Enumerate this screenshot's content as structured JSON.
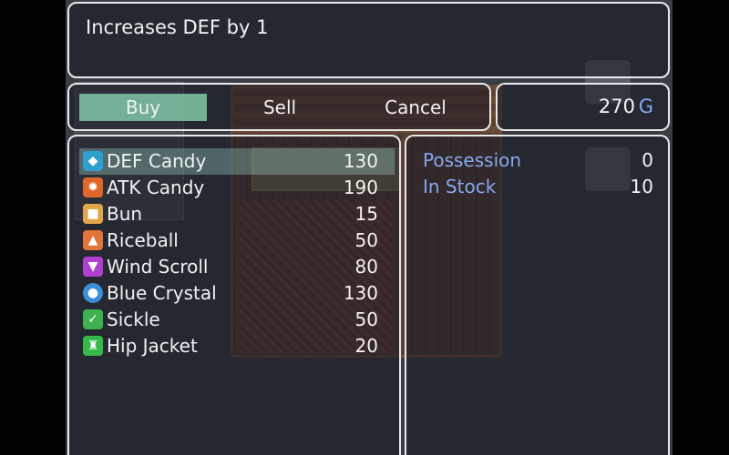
{
  "help": {
    "text": "Increases DEF by 1"
  },
  "commands": [
    {
      "label": "Buy",
      "selected": true
    },
    {
      "label": "Sell",
      "selected": false
    },
    {
      "label": "Cancel",
      "selected": false
    }
  ],
  "gold": {
    "value": "270",
    "unit": "G"
  },
  "items": [
    {
      "name": "DEF Candy",
      "price": "130",
      "icon": "def-candy-icon",
      "color": "#2f9fd0",
      "selected": true
    },
    {
      "name": "ATK Candy",
      "price": "190",
      "icon": "atk-candy-icon",
      "color": "#e0672a",
      "selected": false
    },
    {
      "name": "Bun",
      "price": "15",
      "icon": "bun-icon",
      "color": "#e2a64a",
      "selected": false
    },
    {
      "name": "Riceball",
      "price": "50",
      "icon": "riceball-icon",
      "color": "#e2733a",
      "selected": false
    },
    {
      "name": "Wind Scroll",
      "price": "80",
      "icon": "wind-scroll-icon",
      "color": "#b13fd0",
      "selected": false
    },
    {
      "name": "Blue Crystal",
      "price": "130",
      "icon": "blue-crystal-icon",
      "color": "#3a8fd8",
      "selected": false
    },
    {
      "name": "Sickle",
      "price": "50",
      "icon": "sickle-icon",
      "color": "#3fb050",
      "selected": false
    },
    {
      "name": "Hip Jacket",
      "price": "20",
      "icon": "hip-jacket-icon",
      "color": "#36b84a",
      "selected": false
    }
  ],
  "status": {
    "possession_label": "Possession",
    "possession_value": "0",
    "stock_label": "In Stock",
    "stock_value": "10"
  },
  "colors": {
    "system_text": "#85a8f0",
    "selection": "#8cdcb4"
  }
}
